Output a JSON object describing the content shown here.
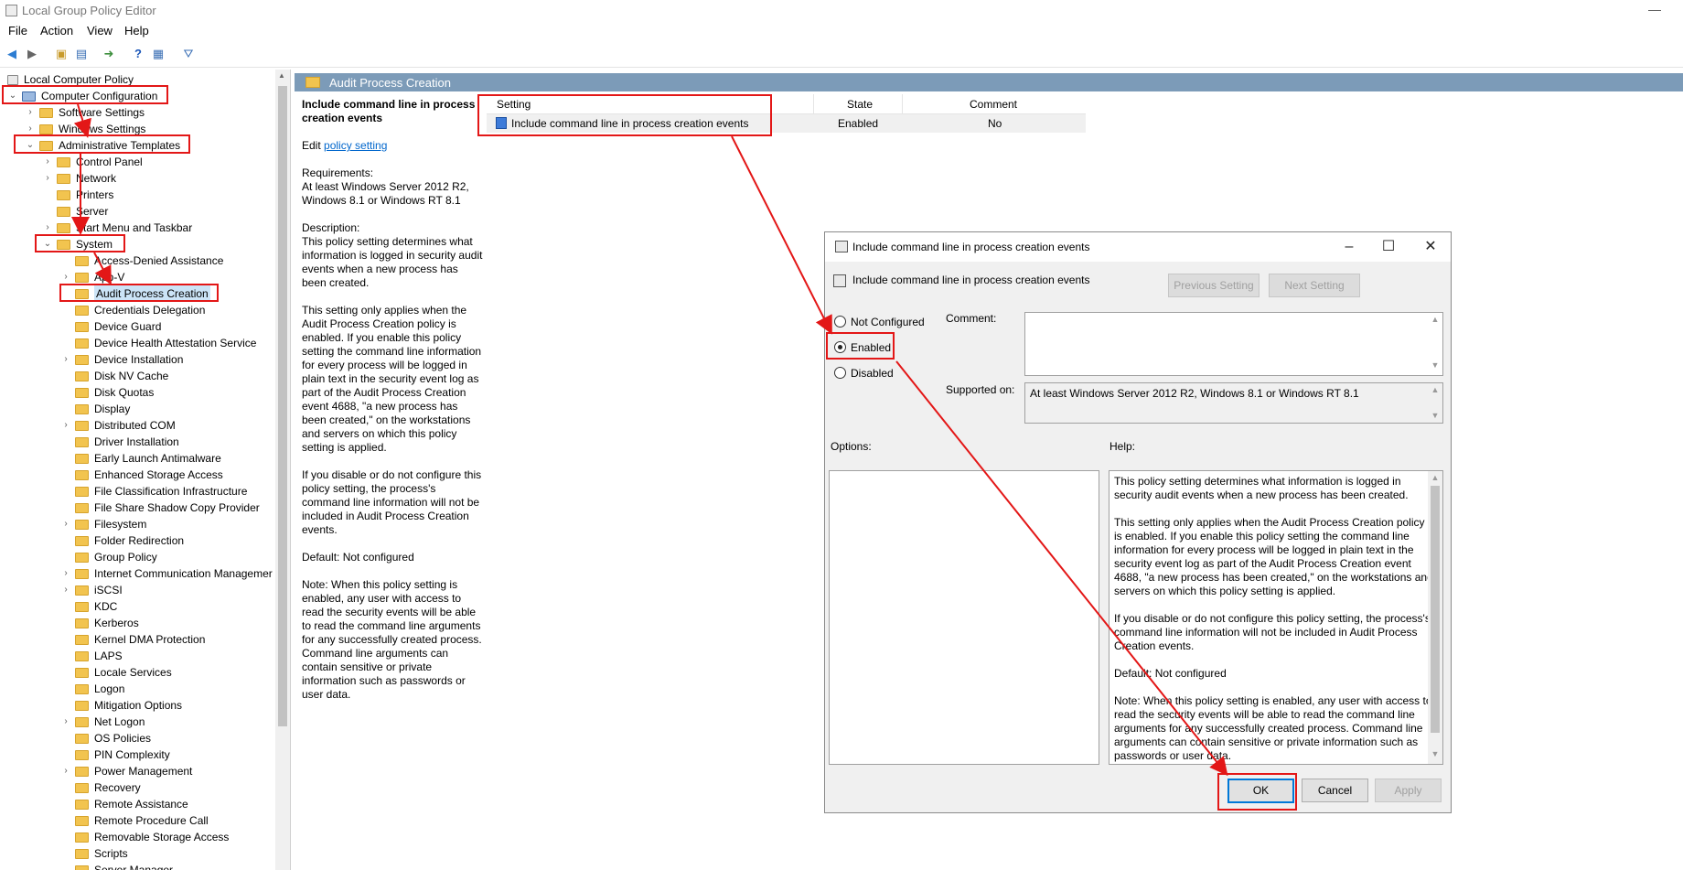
{
  "window": {
    "title": "Local Group Policy Editor",
    "minimize": "—"
  },
  "menu": [
    "File",
    "Action",
    "View",
    "Help"
  ],
  "tree": {
    "root": "Local Computer Policy",
    "computer_config": "Computer Configuration",
    "software_settings": "Software Settings",
    "windows_settings": "Windows Settings",
    "admin_templates": "Administrative Templates",
    "control_panel": "Control Panel",
    "network": "Network",
    "printers": "Printers",
    "server": "Server",
    "start_menu": "Start Menu and Taskbar",
    "system": "System",
    "system_items": [
      "Access-Denied Assistance",
      "App-V",
      "Audit Process Creation",
      "Credentials Delegation",
      "Device Guard",
      "Device Health Attestation Service",
      "Device Installation",
      "Disk NV Cache",
      "Disk Quotas",
      "Display",
      "Distributed COM",
      "Driver Installation",
      "Early Launch Antimalware",
      "Enhanced Storage Access",
      "File Classification Infrastructure",
      "File Share Shadow Copy Provider",
      "Filesystem",
      "Folder Redirection",
      "Group Policy",
      "Internet Communication Managemer",
      "iSCSI",
      "KDC",
      "Kerberos",
      "Kernel DMA Protection",
      "LAPS",
      "Locale Services",
      "Logon",
      "Mitigation Options",
      "Net Logon",
      "OS Policies",
      "PIN Complexity",
      "Power Management",
      "Recovery",
      "Remote Assistance",
      "Remote Procedure Call",
      "Removable Storage Access",
      "Scripts",
      "Server Manager"
    ]
  },
  "folder_header": "Audit Process Creation",
  "description": {
    "title": "Include command line in process creation events",
    "edit_prefix": "Edit ",
    "edit_link": "policy setting",
    "requirements_label": "Requirements:",
    "requirements": "At least Windows Server 2012 R2, Windows 8.1 or Windows RT 8.1",
    "description_label": "Description:",
    "p1": "This policy setting determines what information is logged in security audit events when a new process has been created.",
    "p2": "This setting only applies when the Audit Process Creation policy is enabled. If you enable this policy setting the command line information for every process will be logged in plain text in the security event log as part of the Audit Process Creation event 4688, \"a new process has been created,\" on the workstations and servers on which this policy setting is applied.",
    "p3": "If you disable or do not configure this policy setting, the process's command line information will not be included in Audit Process Creation events.",
    "p4": "Default: Not configured",
    "p5": "Note: When this policy setting is enabled, any user with access to read the security events will be able to read the command line arguments for any successfully created process. Command line arguments can contain sensitive or private information such as passwords or user data."
  },
  "list": {
    "col_setting": "Setting",
    "col_state": "State",
    "col_comment": "Comment",
    "row_setting": "Include command line in process creation events",
    "row_state": "Enabled",
    "row_comment": "No"
  },
  "dialog": {
    "title": "Include command line in process creation events",
    "header": "Include command line in process creation events",
    "prev": "Previous Setting",
    "next": "Next Setting",
    "not_configured": "Not Configured",
    "enabled": "Enabled",
    "disabled": "Disabled",
    "selected": "Enabled",
    "comment_label": "Comment:",
    "supported_label": "Supported on:",
    "supported_value": "At least Windows Server 2012 R2, Windows 8.1 or Windows RT 8.1",
    "options_label": "Options:",
    "help_label": "Help:",
    "help_p1": "This policy setting determines what information is logged in security audit events when a new process has been created.",
    "help_p2": "This setting only applies when the Audit Process Creation policy is enabled. If you enable this policy setting the command line information for every process will be logged in plain text in the security event log as part of the Audit Process Creation event 4688, \"a new process has been created,\" on the workstations and servers on which this policy setting is applied.",
    "help_p3": "If you disable or do not configure this policy setting, the process's command line information will not be included in Audit Process Creation events.",
    "help_p4": "Default: Not configured",
    "help_p5": "Note: When this policy setting is enabled, any user with access to read the security events will be able to read the command line arguments for any successfully created process. Command line arguments can contain sensitive or private information such as passwords or user data.",
    "ok": "OK",
    "cancel": "Cancel",
    "apply": "Apply"
  },
  "colors": {
    "annotation": "#e31717",
    "header_bar": "#7c9bb8",
    "link": "#0066cc"
  }
}
